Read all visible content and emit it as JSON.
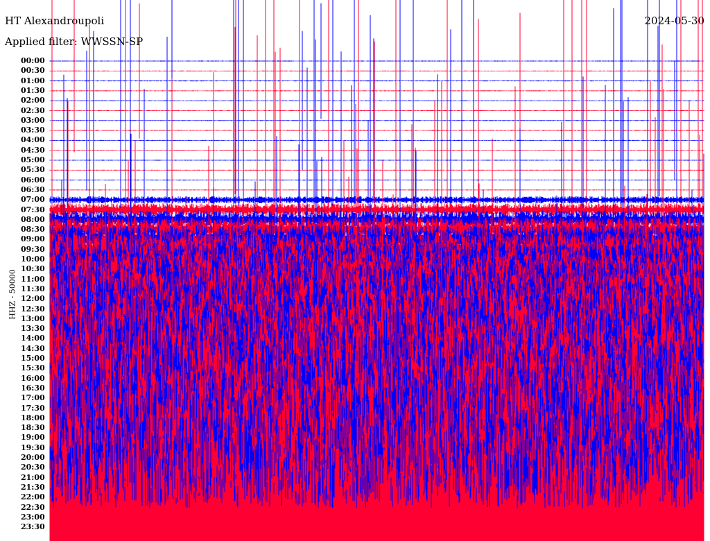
{
  "header": {
    "station": "HT Alexandroupoli",
    "filter": "Applied filter: WWSSN-SP",
    "date": "2024-05-30"
  },
  "chart_data": {
    "type": "line",
    "title": "HT Alexandroupoli",
    "subtitle": "Applied filter: WWSSN-SP",
    "date": "2024-05-30",
    "ylabel": "HHZ - 50000",
    "row_labels": [
      "00:00",
      "00:30",
      "01:00",
      "01:30",
      "02:00",
      "02:30",
      "03:00",
      "03:30",
      "04:00",
      "04:30",
      "05:00",
      "05:30",
      "06:00",
      "06:30",
      "07:00",
      "07:30",
      "08:00",
      "08:30",
      "09:00",
      "09:30",
      "10:00",
      "10:30",
      "11:00",
      "11:30",
      "12:00",
      "12:30",
      "13:00",
      "13:30",
      "14:00",
      "14:30",
      "15:00",
      "15:30",
      "16:00",
      "16:30",
      "17:00",
      "17:30",
      "18:00",
      "18:30",
      "19:00",
      "19:30",
      "20:00",
      "20:30",
      "21:00",
      "21:30",
      "22:00",
      "22:30",
      "23:00",
      "23:30"
    ],
    "series_colors": [
      "#0000ff",
      "#ff0033"
    ],
    "grid": false
  }
}
